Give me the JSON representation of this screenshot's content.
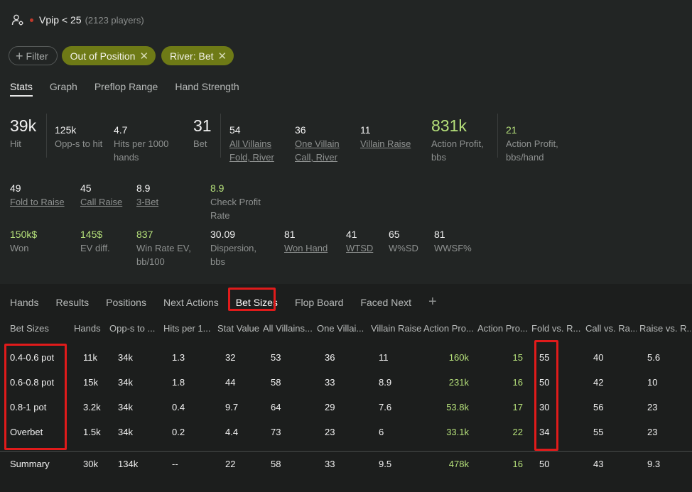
{
  "filter": {
    "title": "Vpip < 25",
    "count": "(2123 players)"
  },
  "chips": {
    "add_label": "Filter",
    "items": [
      "Out of Position",
      "River: Bet"
    ]
  },
  "stat_tabs": [
    "Stats",
    "Graph",
    "Preflop Range",
    "Hand Strength"
  ],
  "stats": {
    "hit": {
      "value": "39k",
      "label": "Hit"
    },
    "opps": {
      "value": "125k",
      "label": "Opp-s to hit"
    },
    "hits_per": {
      "value": "4.7",
      "label1": "Hits per 1000",
      "label2": "hands"
    },
    "bet": {
      "value": "31",
      "label": "Bet"
    },
    "all_villains": {
      "value": "54",
      "label1": "All Villains",
      "label2": "Fold, River"
    },
    "one_villain": {
      "value": "36",
      "label1": "One Villain",
      "label2": "Call, River"
    },
    "villain_raise": {
      "value": "11",
      "label": "Villain Raise"
    },
    "action_profit": {
      "value": "831k",
      "label1": "Action Profit,",
      "label2": "bbs"
    },
    "action_profit_hand": {
      "value": "21",
      "label1": "Action Profit,",
      "label2": "bbs/hand"
    },
    "fold_to_raise": {
      "value": "49",
      "label": "Fold to Raise"
    },
    "call_raise": {
      "value": "45",
      "label": "Call Raise"
    },
    "three_bet": {
      "value": "8.9",
      "label": "3-Bet"
    },
    "check_profit": {
      "value": "8.9",
      "label1": "Check Profit",
      "label2": "Rate"
    },
    "won": {
      "value": "150k$",
      "label": "Won"
    },
    "ev_diff": {
      "value": "145$",
      "label": "EV diff."
    },
    "win_rate": {
      "value": "837",
      "label1": "Win Rate EV,",
      "label2": "bb/100"
    },
    "dispersion": {
      "value": "30.09",
      "label1": "Dispersion,",
      "label2": "bbs"
    },
    "won_hand": {
      "value": "81",
      "label": "Won Hand"
    },
    "wtsd": {
      "value": "41",
      "label": "WTSD"
    },
    "wsd": {
      "value": "65",
      "label": "W%SD"
    },
    "wwsf": {
      "value": "81",
      "label": "WWSF%"
    }
  },
  "bottom_tabs": [
    "Hands",
    "Results",
    "Positions",
    "Next Actions",
    "Bet Sizes",
    "Flop Board",
    "Faced Next"
  ],
  "add_tab_label": "+",
  "table": {
    "headers": [
      "Bet Sizes",
      "Hands",
      "Opp-s to ...",
      "Hits per 1...",
      "Stat Value",
      "All Villains...",
      "One Villai...",
      "Villain Raise",
      "Action Pro...",
      "Action Pro...",
      "Fold vs. R...",
      "Call vs. Ra...",
      "Raise vs. R..."
    ],
    "rows": [
      [
        "0.4-0.6 pot",
        "11k",
        "34k",
        "1.3",
        "32",
        "53",
        "36",
        "11",
        "160k",
        "15",
        "55",
        "40",
        "5.6"
      ],
      [
        "0.6-0.8 pot",
        "15k",
        "34k",
        "1.8",
        "44",
        "58",
        "33",
        "8.9",
        "231k",
        "16",
        "50",
        "42",
        "10"
      ],
      [
        "0.8-1 pot",
        "3.2k",
        "34k",
        "0.4",
        "9.7",
        "64",
        "29",
        "7.6",
        "53.8k",
        "17",
        "30",
        "56",
        "23"
      ],
      [
        "Overbet",
        "1.5k",
        "34k",
        "0.2",
        "4.4",
        "73",
        "23",
        "6",
        "33.1k",
        "22",
        "34",
        "55",
        "23"
      ]
    ],
    "summary": [
      "Summary",
      "30k",
      "134k",
      "--",
      "22",
      "58",
      "33",
      "9.5",
      "478k",
      "16",
      "50",
      "43",
      "9.3"
    ]
  },
  "colors": {
    "accent_green": "#b5e07a",
    "chip_olive": "#6e7a16",
    "highlight_red": "#e01b1b"
  }
}
